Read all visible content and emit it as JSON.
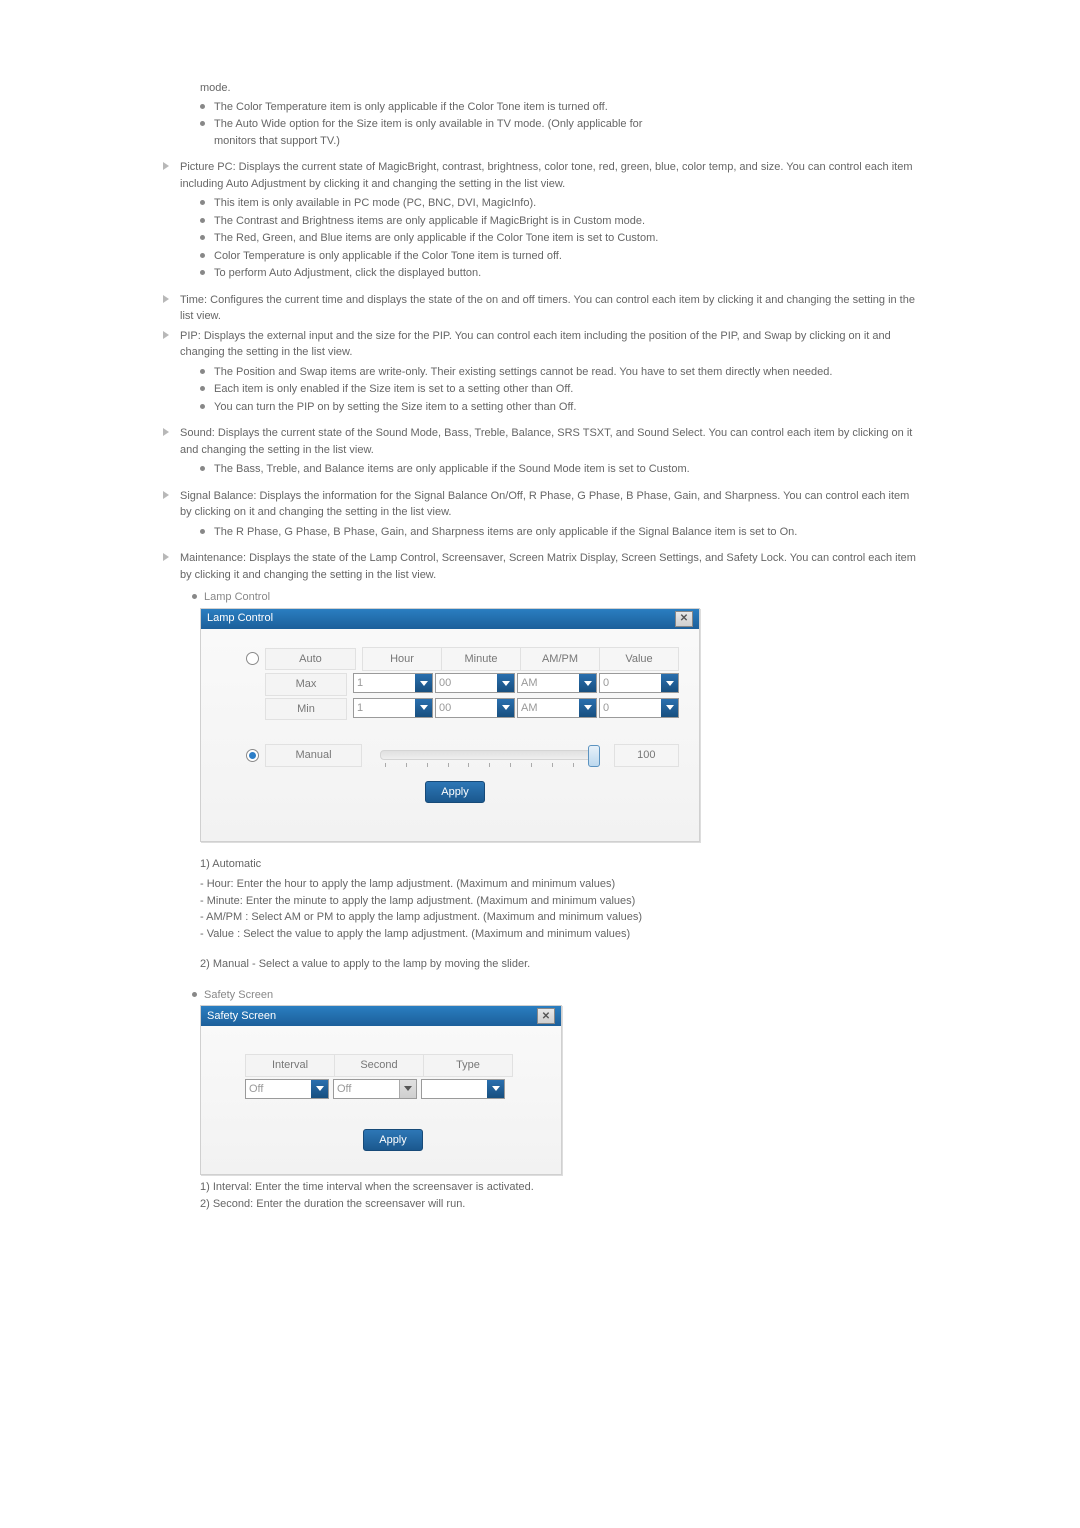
{
  "intro": {
    "mode_word": "mode.",
    "color_temp": "The Color Temperature item is only applicable if the Color Tone item is turned off.",
    "auto_wide_a": "The Auto Wide option for the Size item is only available in TV mode. (Only applicable for",
    "auto_wide_b": "monitors that support TV.)"
  },
  "picture_pc": {
    "p1": "Picture PC: Displays the current state of MagicBright, contrast, brightness, color tone, red, green, blue, color temp, and size. You can control each item including Auto Adjustment by clicking it and changing the setting in the list view.",
    "b1": "This item is only available in PC mode (PC, BNC, DVI, MagicInfo).",
    "b2": "The Contrast and Brightness items are only applicable if MagicBright is in Custom mode.",
    "b3": "The Red, Green, and Blue items are only applicable if the Color Tone item is set to Custom.",
    "b4": "Color Temperature is only applicable if the Color Tone item is turned off.",
    "b5": "To perform Auto Adjustment, click the displayed button."
  },
  "time": "Time: Configures the current time and displays the state of the on and off timers. You can control each item by clicking it and changing the setting in the list view.",
  "pip": {
    "p": "PIP: Displays the external input and the size for the PIP. You can control each item including the position of the PIP, and Swap by clicking on it and changing the setting in the list view.",
    "b1": "The Position and Swap items are write-only. Their existing settings cannot be read. You have to set them directly when needed.",
    "b2": "Each item is only enabled if the Size item is set to a setting other than Off.",
    "b3": "You can turn the PIP on by setting the Size item to a setting other than Off."
  },
  "sound": {
    "p": "Sound: Displays the current state of the Sound Mode, Bass, Treble, Balance, SRS TSXT, and Sound Select. You can control each item by clicking on it and changing the setting in the list view.",
    "b1": "The Bass, Treble, and Balance items are only applicable if the Sound Mode item is set to Custom."
  },
  "signal": {
    "p": "Signal Balance: Displays the information for the Signal Balance On/Off, R Phase, G Phase, B Phase, Gain, and Sharpness. You can control each item by clicking on it and changing the setting in the list view.",
    "b1": "The R Phase, G Phase, B Phase, Gain, and Sharpness items are only applicable if the Signal Balance item is set to On."
  },
  "maintenance": "Maintenance: Displays the state of the Lamp Control, Screensaver, Screen Matrix Display, Screen Settings, and Safety Lock. You can control each item by clicking it and changing the setting in the list view.",
  "lamp": {
    "section_title": "Lamp Control",
    "panel_title": "Lamp Control",
    "auto": "Auto",
    "hour": "Hour",
    "minute": "Minute",
    "ampm": "AM/PM",
    "value_head": "Value",
    "max": "Max",
    "min": "Min",
    "manual": "Manual",
    "hour_val": "1",
    "minute_val": "00",
    "ampm_val": "AM",
    "value_val": "0",
    "manual_value": "100",
    "apply": "Apply",
    "auto_heading": "1) Automatic",
    "n_hour": "- Hour: Enter the hour to apply the lamp adjustment. (Maximum and minimum values)",
    "n_minute": "- Minute: Enter the minute to apply the lamp adjustment. (Maximum and minimum values)",
    "n_ampm": "- AM/PM : Select AM or PM to apply the lamp adjustment. (Maximum and minimum values)",
    "n_value": "- Value : Select the value to apply the lamp adjustment. (Maximum and minimum values)",
    "manual_heading": "2) Manual - Select a value to apply to the lamp by moving the slider."
  },
  "safety": {
    "section_title": "Safety Screen",
    "panel_title": "Safety Screen",
    "interval": "Interval",
    "second": "Second",
    "type": "Type",
    "interval_val": "Off",
    "second_val": "Off",
    "type_val": "",
    "apply": "Apply",
    "f1": "1) Interval: Enter the time interval when the screensaver is activated.",
    "f2": "2) Second: Enter the duration the screensaver will run."
  }
}
